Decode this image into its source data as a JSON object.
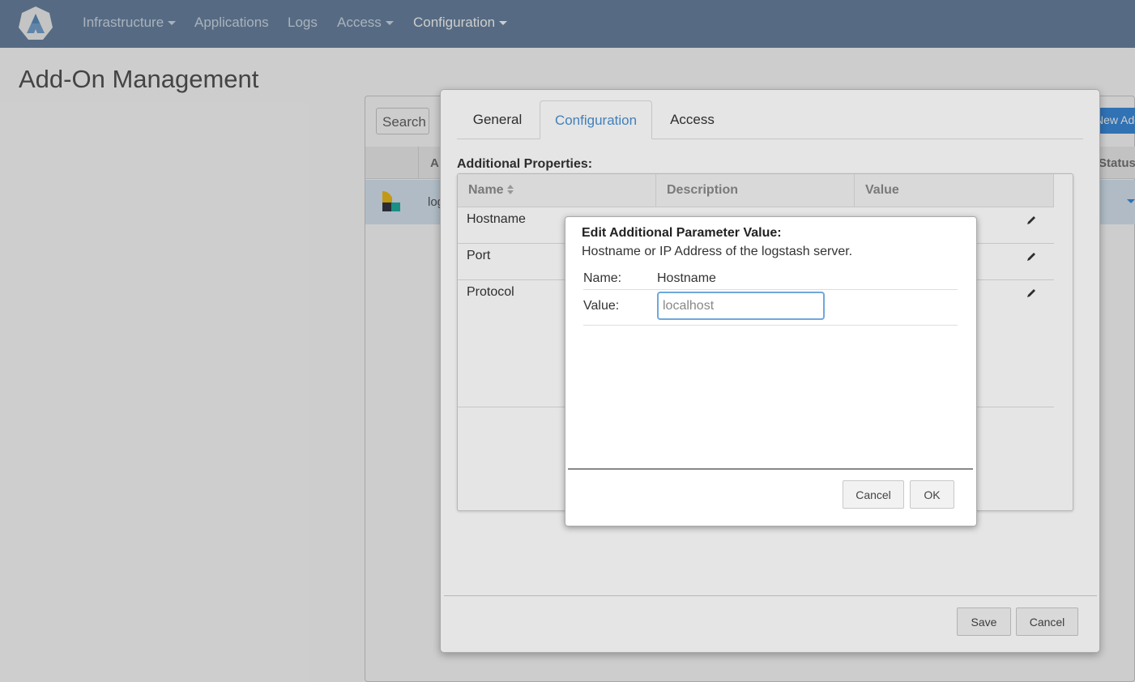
{
  "navbar": {
    "items": [
      {
        "label": "Infrastructure",
        "dropdown": true
      },
      {
        "label": "Applications",
        "dropdown": false
      },
      {
        "label": "Logs",
        "dropdown": false
      },
      {
        "label": "Access",
        "dropdown": true
      },
      {
        "label": "Configuration",
        "dropdown": true,
        "active": true
      }
    ]
  },
  "page": {
    "title": "Add-On Management"
  },
  "background_table": {
    "search_label": "Search",
    "new_button": "New Add-On",
    "header_col_a": "A",
    "header_col_status": "Status",
    "row_text": "logstash"
  },
  "addon_modal": {
    "tabs": [
      {
        "label": "General",
        "active": false
      },
      {
        "label": "Configuration",
        "active": true
      },
      {
        "label": "Access",
        "active": false
      }
    ],
    "section_title": "Additional Properties:",
    "columns": [
      "Name",
      "Description",
      "Value"
    ],
    "rows": [
      {
        "name": "Hostname"
      },
      {
        "name": "Port"
      },
      {
        "name": "Protocol"
      }
    ],
    "save_label": "Save",
    "cancel_label": "Cancel"
  },
  "edit_dialog": {
    "title": "Edit Additional Parameter Value:",
    "description": "Hostname or IP Address of the logstash server.",
    "name_label": "Name:",
    "name_value": "Hostname",
    "value_label": "Value:",
    "value_input": "localhost",
    "cancel_label": "Cancel",
    "ok_label": "OK"
  },
  "colors": {
    "navbar": "#6b86a3",
    "accent": "#4a8fd0",
    "primary_button": "#3d8ee0"
  }
}
